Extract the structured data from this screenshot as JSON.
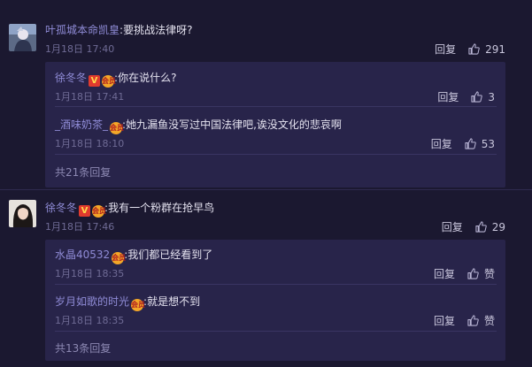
{
  "comments": [
    {
      "user": "叶孤城本命凯皇",
      "text": "要挑战法律呀?",
      "date": "1月18日 17:40",
      "reply_label": "回复",
      "likes": "291",
      "replies": [
        {
          "user": "徐冬冬",
          "text": "你在说什么?",
          "date": "1月18日 17:41",
          "reply_label": "回复",
          "likes": "3"
        },
        {
          "user": "_酒味奶茶_",
          "text": "她九漏鱼没写过中国法律吧,诶没文化的悲哀啊",
          "date": "1月18日 18:10",
          "reply_label": "回复",
          "likes": "53"
        }
      ],
      "more": "共21条回复"
    },
    {
      "user": "徐冬冬",
      "text": "我有一个粉群在抢早鸟",
      "date": "1月18日 17:46",
      "reply_label": "回复",
      "likes": "29",
      "replies": [
        {
          "user": "水晶40532",
          "text": "我们都已经看到了",
          "date": "1月18日 18:35",
          "reply_label": "回复",
          "likes": "赞"
        },
        {
          "user": "岁月如歌的时光",
          "text": "就是想不到",
          "date": "1月18日 18:35",
          "reply_label": "回复",
          "likes": "赞"
        }
      ],
      "more": "共13条回复"
    }
  ],
  "badges": {
    "v": "V",
    "member": "会员"
  },
  "colors": {
    "background": "#1b1830",
    "panel": "#28244a",
    "username": "#8f8bd6",
    "meta": "#6f6b95"
  }
}
